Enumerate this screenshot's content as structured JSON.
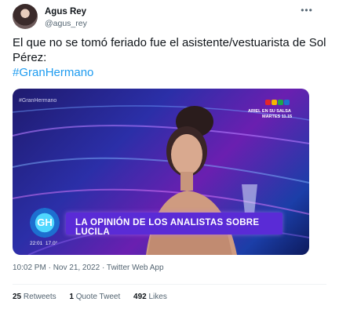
{
  "author": {
    "display_name": "Agus Rey",
    "handle": "@agus_rey",
    "avatar_icon": "user-avatar"
  },
  "more_icon": "more-dots-icon",
  "tweet": {
    "text": "El que no se tomó feriado fue el asistente/vestuarista de Sol Pérez:",
    "hashtag": "#GranHermano"
  },
  "media": {
    "corner_tag": "#GranHermano",
    "promo_line1": "ARIEL EN SU SALSA",
    "promo_line2": "MARTES 11.15",
    "lower_third": "LA OPINIÓN DE LOS ANALISTAS SOBRE LUCILA",
    "logo_text": "GH",
    "time": "22:01",
    "temperature": "17.0°",
    "channel_colors": [
      "#e4262b",
      "#f6b700",
      "#1ba84a",
      "#1d6fd0"
    ]
  },
  "meta": {
    "timestamp": "10:02 PM · Nov 21, 2022 · Twitter Web App"
  },
  "stats": {
    "retweets_count": "25",
    "retweets_label": "Retweets",
    "quotes_count": "1",
    "quotes_label": "Quote Tweet",
    "likes_count": "492",
    "likes_label": "Likes"
  }
}
